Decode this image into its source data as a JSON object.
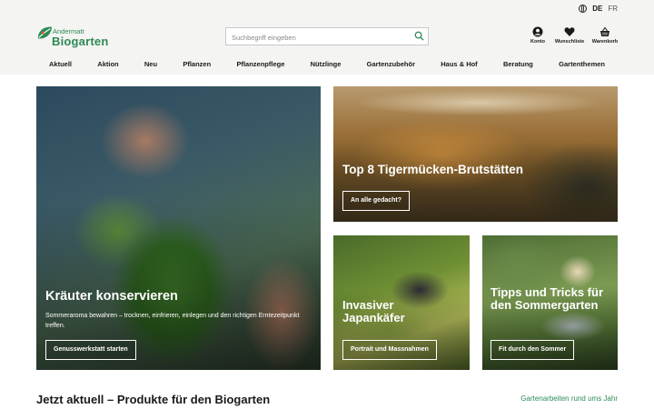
{
  "lang": {
    "current": "DE",
    "other": "FR"
  },
  "logo": {
    "line1": "Andermatt",
    "line2": "Biogarten"
  },
  "search": {
    "placeholder": "Suchbegriff eingeben"
  },
  "header_actions": [
    {
      "label": "Konto",
      "icon": "user-icon"
    },
    {
      "label": "Wunschliste",
      "icon": "heart-icon"
    },
    {
      "label": "Warenkorb",
      "icon": "basket-icon"
    }
  ],
  "nav": [
    "Aktuell",
    "Aktion",
    "Neu",
    "Pflanzen",
    "Pflanzenpflege",
    "Nützlinge",
    "Gartenzubehör",
    "Haus & Hof",
    "Beratung",
    "Gartenthemen"
  ],
  "tiles": {
    "herbs": {
      "title": "Kräuter konservieren",
      "text": "Sommeraroma bewahren – trocknen, einfrieren, einlegen und den richtigen Erntezeitpunkt treffen.",
      "cta": "Genusswerkstatt starten"
    },
    "mosquito": {
      "title": "Top 8 Tigermücken-Brutstätten",
      "cta": "An alle gedacht?"
    },
    "beetle": {
      "title": "Invasiver Japankäfer",
      "cta": "Portrait und Massnahmen"
    },
    "summer": {
      "title": "Tipps und Tricks für den Sommergarten",
      "cta": "Fit durch den Sommer"
    }
  },
  "section": {
    "title": "Jetzt aktuell – Produkte für den Biogarten",
    "link": "Gartenarbeiten rund ums Jahr"
  },
  "colors": {
    "brand_green": "#2c8a55",
    "header_bg": "#f4f4f2"
  }
}
